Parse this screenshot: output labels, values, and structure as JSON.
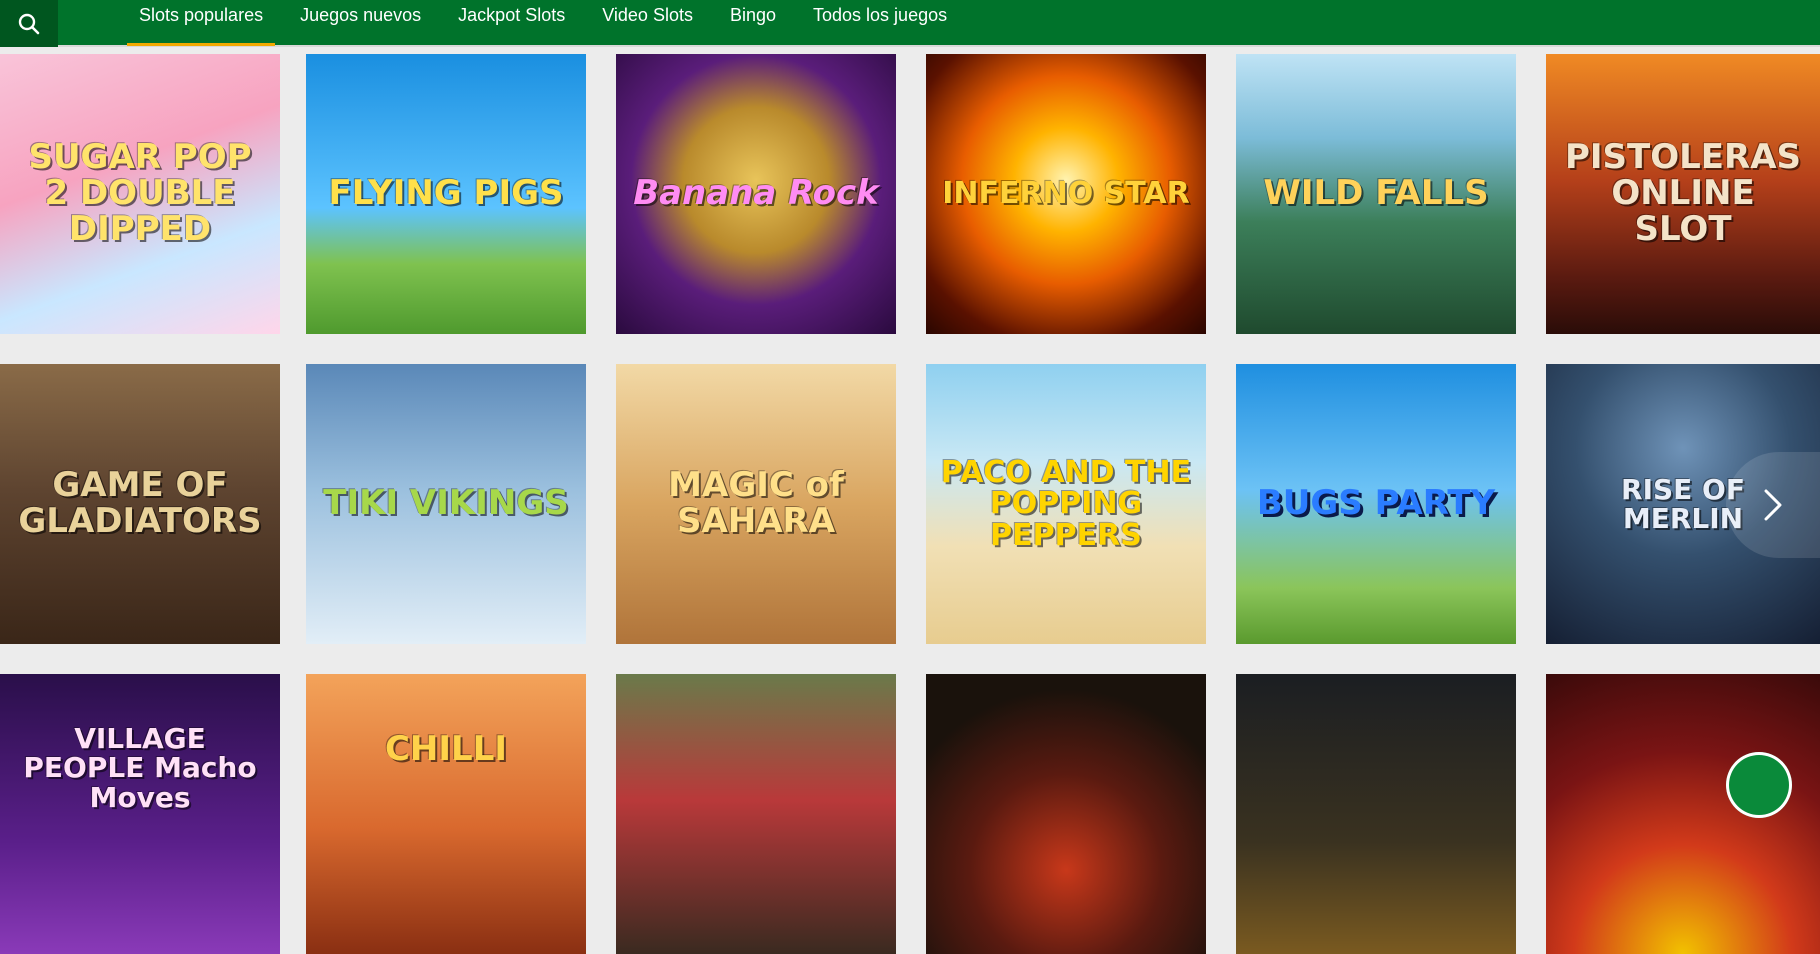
{
  "header": {
    "search_icon": "search-icon",
    "nav": [
      {
        "label": "Slots populares",
        "active": true
      },
      {
        "label": "Juegos nuevos"
      },
      {
        "label": "Jackpot Slots"
      },
      {
        "label": "Video Slots"
      },
      {
        "label": "Bingo"
      },
      {
        "label": "Todos los juegos"
      }
    ],
    "colors": {
      "bar": "#00732b",
      "search_bg": "#00561f",
      "active_underline": "#f2a900"
    }
  },
  "games": {
    "row1": [
      {
        "title": "SUGAR POP 2 DOUBLE DIPPED"
      },
      {
        "title": "FLYING PIGS"
      },
      {
        "title": "Banana Rock"
      },
      {
        "title": "INFERNO STAR"
      },
      {
        "title": "WILD FALLS"
      },
      {
        "title": "PISTOLERAS ONLINE SLOT"
      }
    ],
    "row2": [
      {
        "title": "GAME OF GLADIATORS"
      },
      {
        "title": "TIKI VIKINGS"
      },
      {
        "title": "MAGIC of SAHARA"
      },
      {
        "title": "PACO AND THE POPPING PEPPERS"
      },
      {
        "title": "BUGS PARTY"
      },
      {
        "title": "RISE OF MERLIN"
      }
    ],
    "row3": [
      {
        "title": "VILLAGE PEOPLE Macho Moves"
      },
      {
        "title": "CHILLI"
      },
      {
        "title": ""
      },
      {
        "title": ""
      },
      {
        "title": ""
      },
      {
        "title": ""
      }
    ]
  },
  "controls": {
    "next_icon": "chevron-right-icon",
    "chat_icon": "chat-icon"
  }
}
